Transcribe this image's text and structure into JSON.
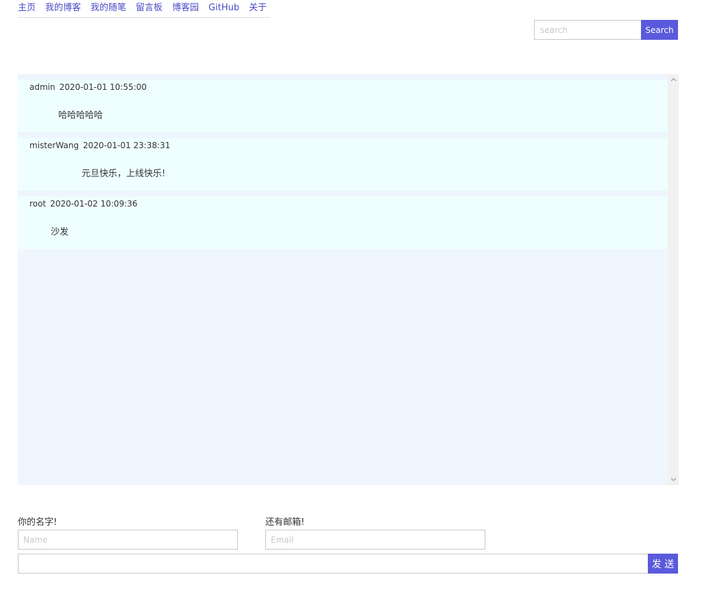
{
  "nav": {
    "items": [
      {
        "label": "主页"
      },
      {
        "label": "我的博客"
      },
      {
        "label": "我的随笔"
      },
      {
        "label": "留言板"
      },
      {
        "label": "博客园"
      },
      {
        "label": "GitHub"
      },
      {
        "label": "关于"
      }
    ]
  },
  "search": {
    "placeholder": "search",
    "value": "",
    "button_label": "Search"
  },
  "messages": [
    {
      "user": "admin",
      "time": "2020-01-01 10:55:00",
      "content": "哈哈哈哈哈"
    },
    {
      "user": "misterWang",
      "time": "2020-01-01 23:38:31",
      "content": "元旦快乐，上线快乐!"
    },
    {
      "user": "root",
      "time": "2020-01-02 10:09:36",
      "content": "沙发"
    }
  ],
  "form": {
    "name_label": "你的名字!",
    "name_placeholder": "Name",
    "email_label": "还有邮箱!",
    "email_placeholder": "Email",
    "message_value": "",
    "send_label": "发 送"
  },
  "colors": {
    "accent": "#5a5adc",
    "link": "#4b4bc8",
    "message_bg": "#effefe",
    "board_bg": "#eff6fe"
  },
  "icons": {
    "scroll_up": "chevron-up-icon",
    "scroll_down": "chevron-down-icon"
  }
}
